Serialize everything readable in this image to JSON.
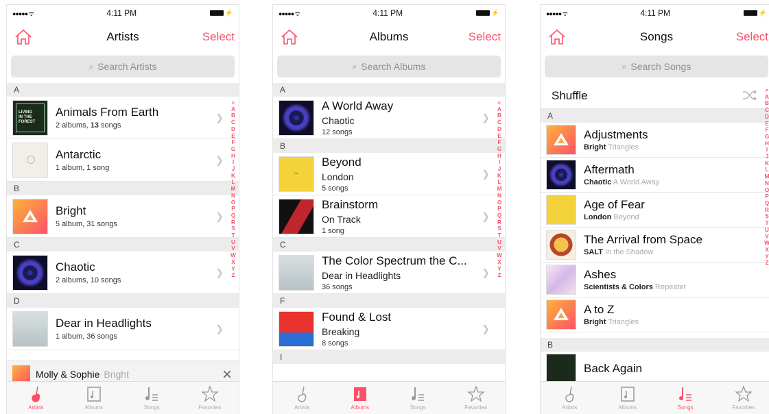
{
  "colors": {
    "accent": "#fb5268",
    "section_bg": "#ececec",
    "search_bg": "#e5e5e5",
    "muted": "#aaaaaa"
  },
  "status": {
    "time": "4:11 PM",
    "signal": "●●●●● ᯤ",
    "battery": "⚡"
  },
  "nav": {
    "select_label": "Select"
  },
  "tabs": [
    "Artists",
    "Albums",
    "Songs",
    "Favorites"
  ],
  "az_index": [
    "⌕",
    "A",
    "B",
    "C",
    "D",
    "E",
    "F",
    "G",
    "H",
    "I",
    "J",
    "K",
    "L",
    "M",
    "N",
    "O",
    "P",
    "Q",
    "R",
    "S",
    "T",
    "U",
    "V",
    "W",
    "X",
    "Y",
    "Z"
  ],
  "artists_screen": {
    "title": "Artists",
    "search_placeholder": "Search Artists",
    "sections": [
      "A",
      "B",
      "C",
      "D"
    ],
    "rows": [
      {
        "name": "Animals From Earth",
        "count_prefix": "2 albums, ",
        "count_bold": "13",
        "count_suffix": " songs",
        "art": "forest-cover"
      },
      {
        "name": "Antarctic",
        "count_prefix": "1 album, 1 song",
        "count_bold": "",
        "count_suffix": "",
        "art": "snow-cover"
      },
      {
        "name": "Bright",
        "count_prefix": "5 album, 31 songs",
        "count_bold": "",
        "count_suffix": "",
        "art": "bright-triangle-cover"
      },
      {
        "name": "Chaotic",
        "count_prefix": "2 albums, 10 songs",
        "count_bold": "",
        "count_suffix": "",
        "art": "purple-orb-cover"
      },
      {
        "name": "Dear in Headlights",
        "count_prefix": "1 album, 36 songs",
        "count_bold": "",
        "count_suffix": "",
        "art": "deer-cover"
      }
    ],
    "mini_player": {
      "title": "Molly & Sophie",
      "artist": "Bright"
    },
    "active_tab": "Artists"
  },
  "albums_screen": {
    "title": "Albums",
    "search_placeholder": "Search Albums",
    "sections": [
      "A",
      "B",
      "C",
      "F",
      "I"
    ],
    "rows": [
      {
        "title": "A World Away",
        "artist": "Chaotic",
        "songs": "12 songs",
        "art": "purple-orb-cover"
      },
      {
        "title": "Beyond",
        "artist": "London",
        "songs": "5 songs",
        "art": "london-cover"
      },
      {
        "title": "Brainstorm",
        "artist": "On Track",
        "songs": "1 song",
        "art": "track-cover"
      },
      {
        "title": "The Color Spectrum the C...",
        "artist": "Dear in Headlights",
        "songs": "36 songs",
        "art": "deer-cover"
      },
      {
        "title": "Found & Lost",
        "artist": "Breaking",
        "songs": "8 songs",
        "art": "breaking-cover"
      }
    ],
    "active_tab": "Albums"
  },
  "songs_screen": {
    "title": "Songs",
    "search_placeholder": "Search Songs",
    "shuffle_label": "Shuffle",
    "sections": [
      "A",
      "B"
    ],
    "rows": [
      {
        "title": "Adjustments",
        "artist": "Bright",
        "album": "Triangles",
        "art": "bright-triangle-cover"
      },
      {
        "title": "Aftermath",
        "artist": "Chaotic",
        "album": "A World Away",
        "art": "purple-orb-cover"
      },
      {
        "title": "Age of Fear",
        "artist": "London",
        "album": "Beyond",
        "art": "london-cover"
      },
      {
        "title": "The Arrival from Space",
        "artist": "SALT",
        "album": "In the Shadow",
        "art": "salt-cover"
      },
      {
        "title": "Ashes",
        "artist": "Scientists & Colors",
        "album": "Repeater",
        "art": "ashes-cover"
      },
      {
        "title": "A to Z",
        "artist": "Bright",
        "album": "Triangles",
        "art": "bright-triangle-cover"
      },
      {
        "title": "Back Again",
        "artist": "",
        "album": "",
        "art": "forest-cover"
      }
    ],
    "active_tab": "Songs"
  }
}
